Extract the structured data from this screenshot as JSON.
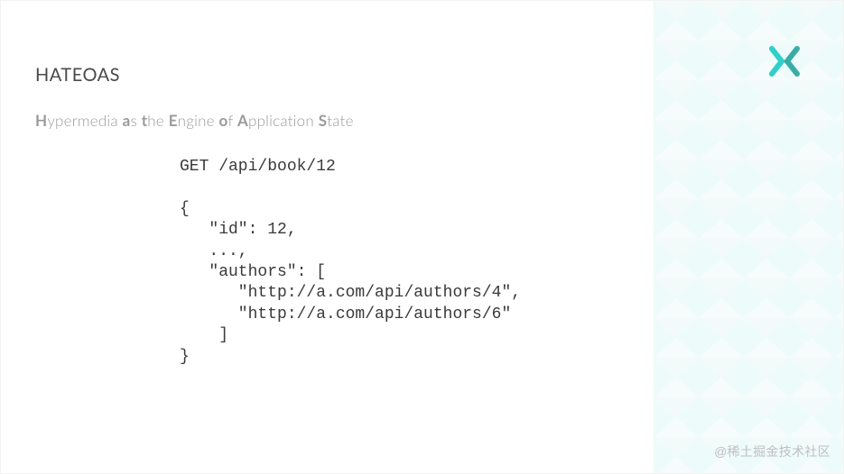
{
  "title": "HATEOAS",
  "subtitle_parts": {
    "h": "H",
    "ypermedia": "ypermedia ",
    "a": "a",
    "s": "s ",
    "t": "t",
    "he": "he ",
    "e": "E",
    "ngine": "ngine ",
    "o": "o",
    "f": "f ",
    "aa": "A",
    "pplication": "pplication ",
    "ss": "S",
    "tate": "tate"
  },
  "code": "GET /api/book/12\n\n{\n   \"id\": 12,\n   ...,\n   \"authors\": [\n      \"http://a.com/api/authors/4\",\n      \"http://a.com/api/authors/6\"\n    ]\n}",
  "watermark": "@稀土掘金技术社区",
  "colors": {
    "accent": "#2fd0c8"
  }
}
